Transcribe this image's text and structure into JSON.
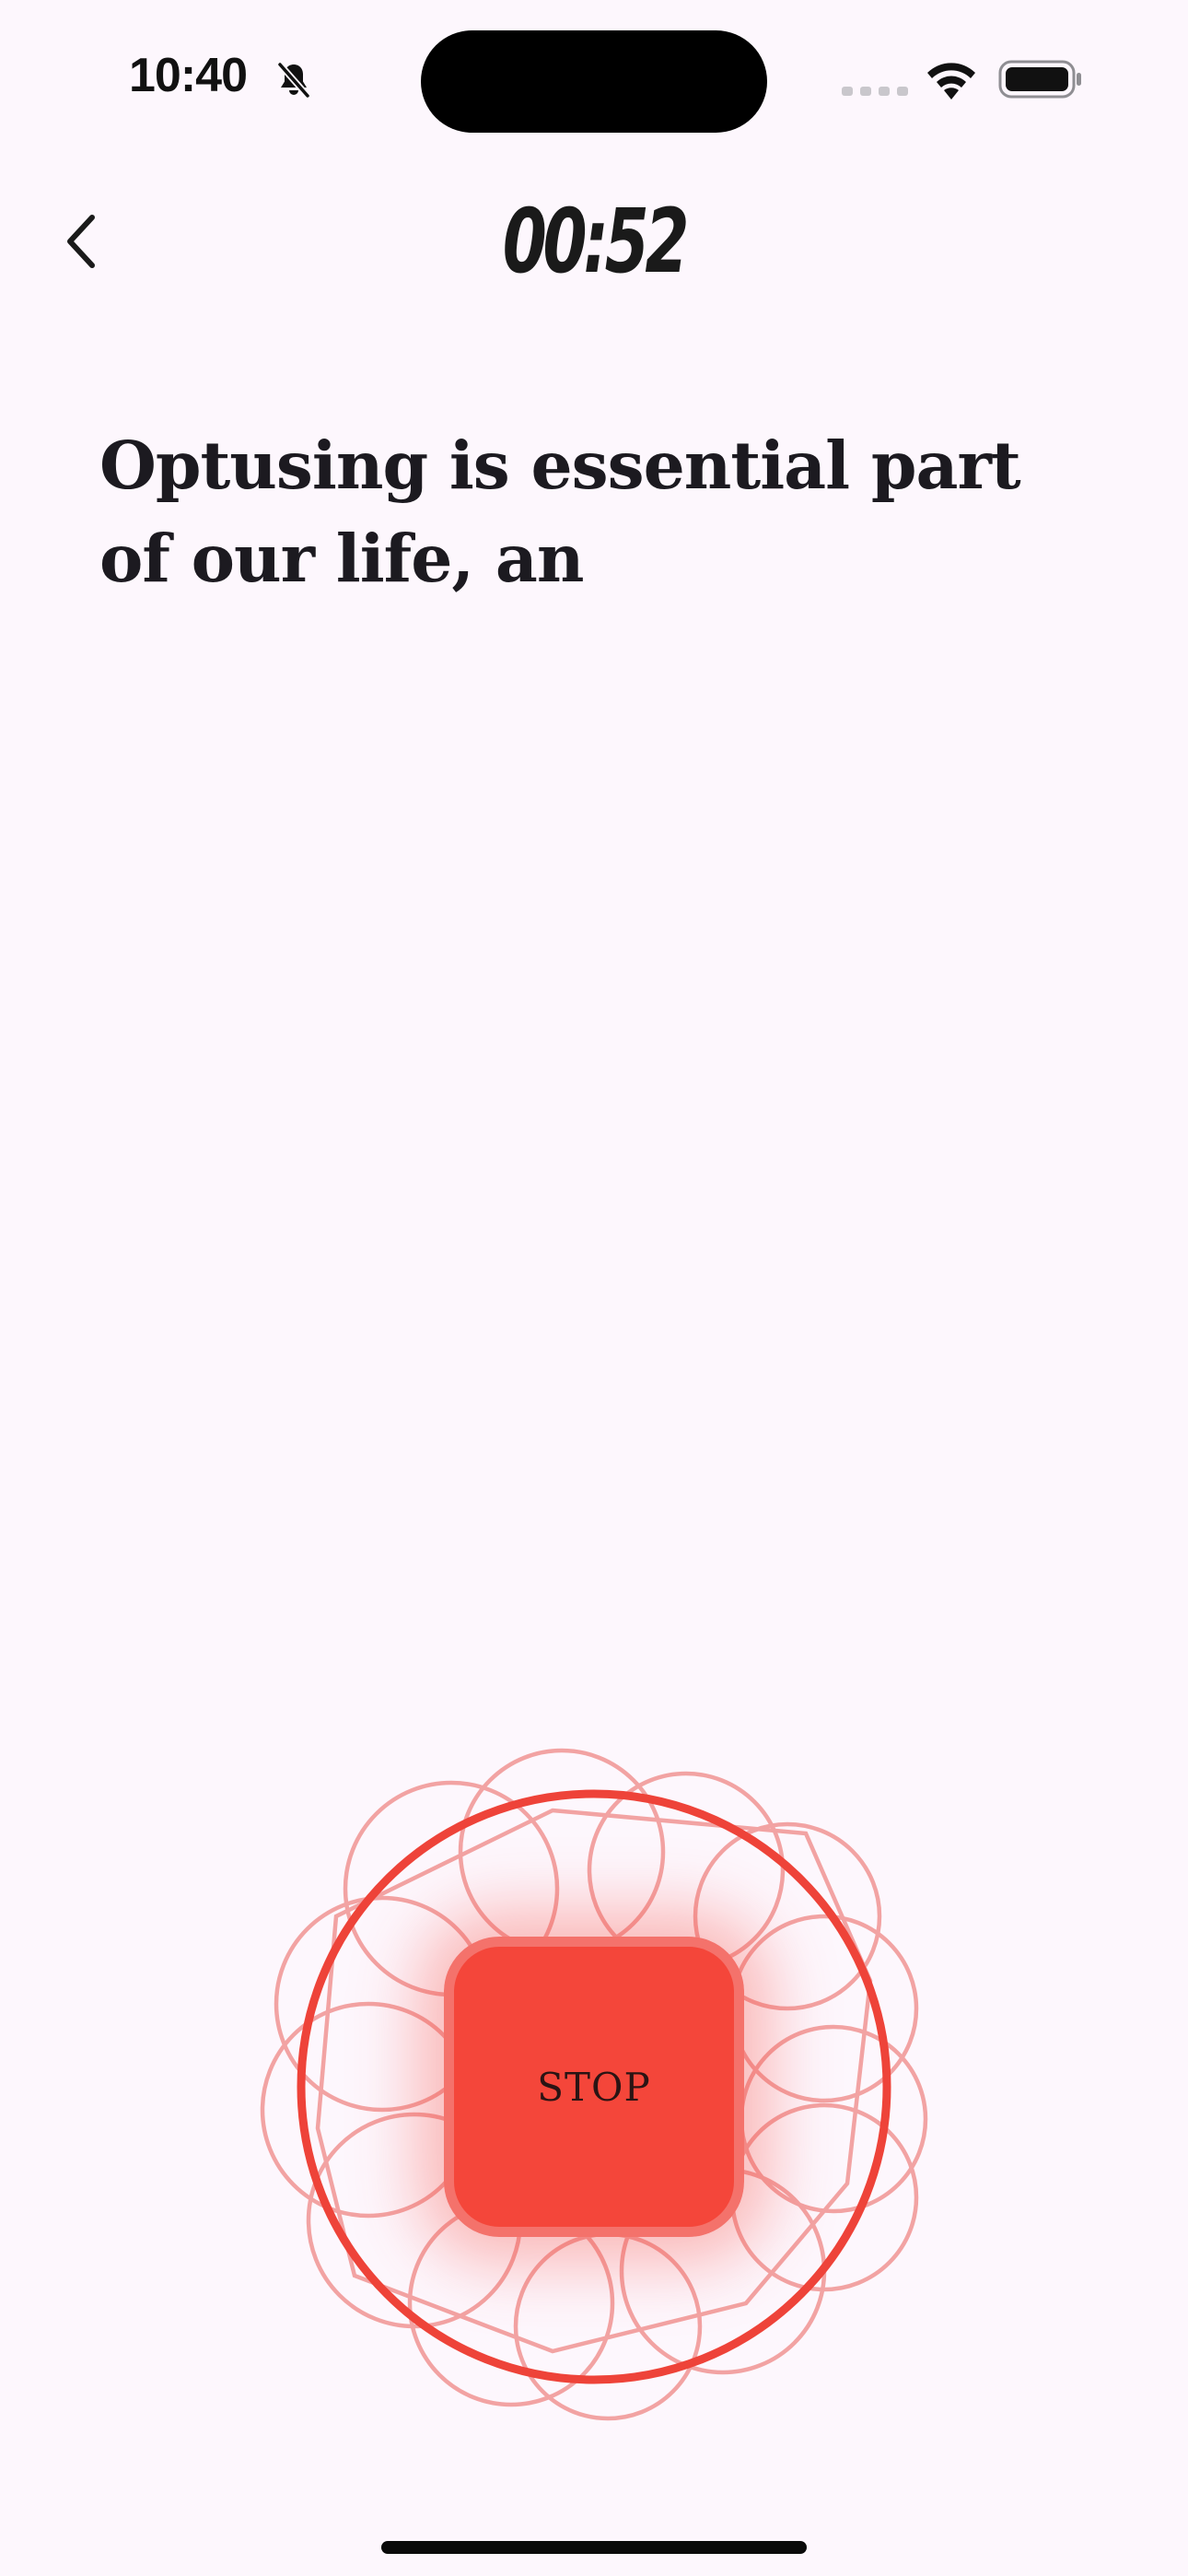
{
  "status_bar": {
    "time": "10:40",
    "silent_icon": "bell-slash-icon",
    "signal_icon": "cellular-signal-icon",
    "wifi_icon": "wifi-icon",
    "battery_icon": "battery-icon"
  },
  "header": {
    "back_icon": "chevron-left-icon",
    "timer": "00:52"
  },
  "transcript": {
    "text": "Optusing is essential part of our life, an"
  },
  "controls": {
    "stop_label": "STOP",
    "accent_color": "#f4463a",
    "ring_color": "#ee4339"
  }
}
